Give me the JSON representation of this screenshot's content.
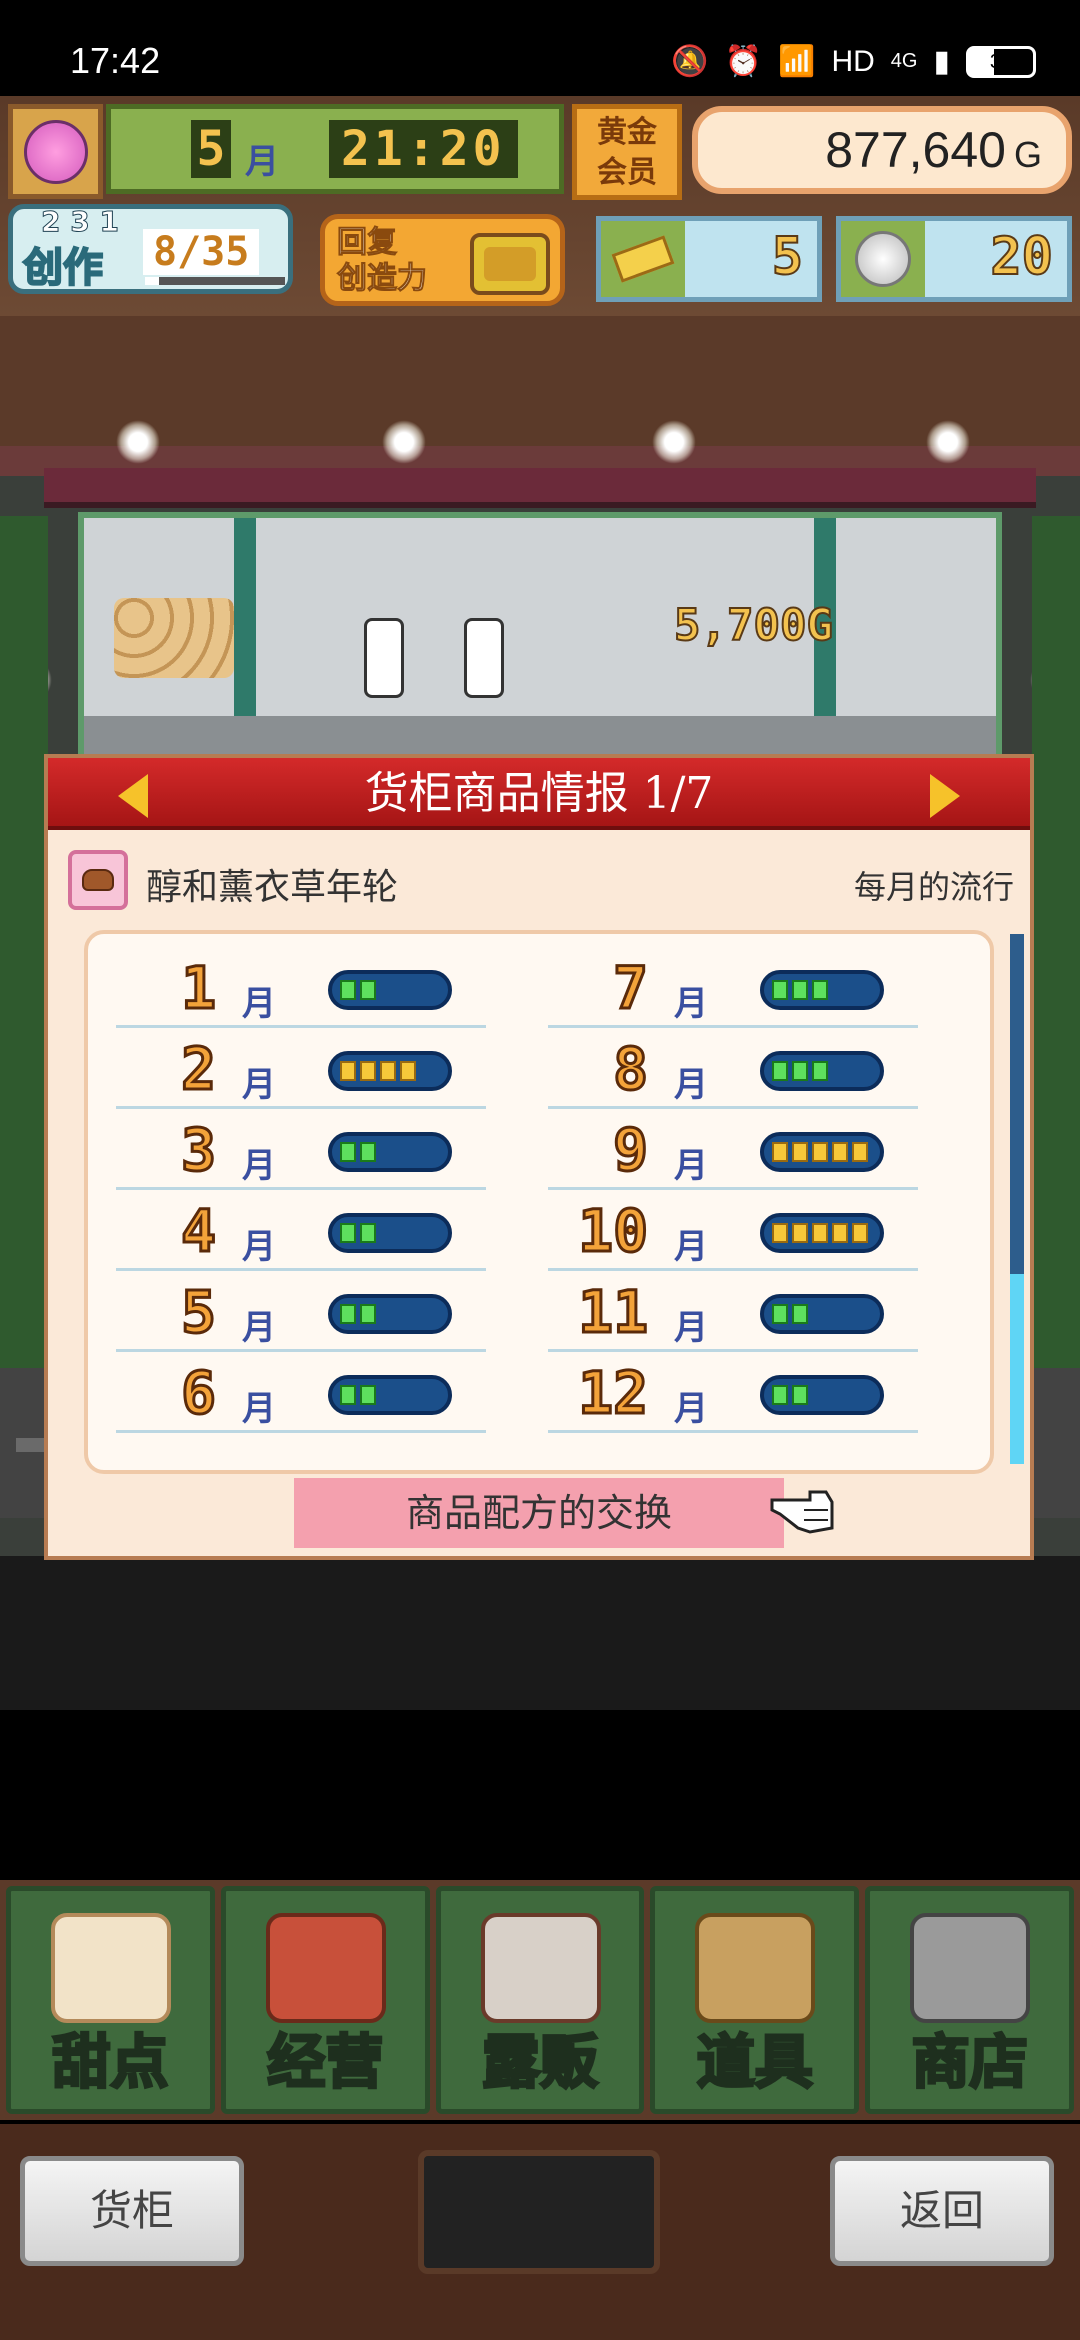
{
  "status_bar": {
    "time": "17:42",
    "network": "HD",
    "signal": "4G",
    "battery": "39"
  },
  "hud": {
    "month_value": "5",
    "month_unit": "月",
    "clock": "21:20",
    "gold_member_line1": "黄金",
    "gold_member_line2": "会员",
    "money": "877,640",
    "money_unit": "G",
    "create_level": "2 3 1",
    "create_label": "创作",
    "create_count": "8/35",
    "create_progress": 0.1,
    "restore_line1": "回复",
    "restore_line2": "创造力",
    "tickets": "5",
    "medals": "20"
  },
  "scene": {
    "floating_price": "5,700G"
  },
  "panel": {
    "title": "货柜商品情报 1/7",
    "item_name": "醇和薰衣草年轮",
    "trend_label": "每月的流行",
    "month_unit": "月",
    "months_left": [
      {
        "num": "1",
        "level": 2,
        "color": "g"
      },
      {
        "num": "2",
        "level": 4,
        "color": "y"
      },
      {
        "num": "3",
        "level": 2,
        "color": "g"
      },
      {
        "num": "4",
        "level": 2,
        "color": "g"
      },
      {
        "num": "5",
        "level": 2,
        "color": "g"
      },
      {
        "num": "6",
        "level": 2,
        "color": "g"
      }
    ],
    "months_right": [
      {
        "num": "7",
        "level": 3,
        "color": "g"
      },
      {
        "num": "8",
        "level": 3,
        "color": "g"
      },
      {
        "num": "9",
        "level": 5,
        "color": "y"
      },
      {
        "num": "10",
        "level": 5,
        "color": "y"
      },
      {
        "num": "11",
        "level": 2,
        "color": "g"
      },
      {
        "num": "12",
        "level": 2,
        "color": "g"
      }
    ],
    "exchange_button": "商品配方的交换"
  },
  "menu": {
    "items": [
      "甜点",
      "经营",
      "露贩",
      "道具",
      "商店"
    ]
  },
  "bottom": {
    "left_button": "货柜",
    "right_button": "返回"
  },
  "colors": {
    "header_red": "#c21f1f",
    "gauge_green": "#5ee05e",
    "gauge_yellow": "#f7c83a"
  }
}
